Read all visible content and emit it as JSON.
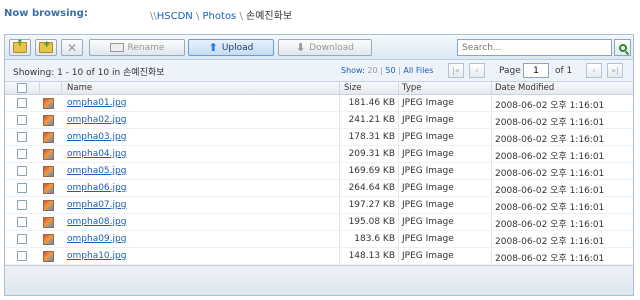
{
  "header": {
    "now_browsing_label": "Now browsing:",
    "breadcrumb_prefix": "\\\\",
    "crumbs": [
      "HSCDN",
      "Photos",
      "손예진화보"
    ],
    "sep": "\\"
  },
  "toolbar": {
    "rename_label": "Rename",
    "upload_label": "Upload",
    "download_label": "Download",
    "search_placeholder": "Search..."
  },
  "info": {
    "showing_text": "Showing: 1 - 10 of 10 in 손예진화보",
    "show_label": "Show:",
    "show_20": "20",
    "show_50": "50",
    "show_all": "All Files",
    "show_sep": "|",
    "page_label": "Page",
    "page_value": "1",
    "of_label": "of 1",
    "nav_first": "|«",
    "nav_prev": "‹",
    "nav_next": "›",
    "nav_last": "»|"
  },
  "columns": {
    "name": "Name",
    "size": "Size",
    "type": "Type",
    "date": "Date Modified"
  },
  "files": [
    {
      "name": "ompha01.jpg",
      "size": "181.46 KB",
      "type": "JPEG Image",
      "date": "2008-06-02 오후 1:16:01"
    },
    {
      "name": "ompha02.jpg",
      "size": "241.21 KB",
      "type": "JPEG Image",
      "date": "2008-06-02 오후 1:16:01"
    },
    {
      "name": "ompha03.jpg",
      "size": "178.31 KB",
      "type": "JPEG Image",
      "date": "2008-06-02 오후 1:16:01"
    },
    {
      "name": "ompha04.jpg",
      "size": "209.31 KB",
      "type": "JPEG Image",
      "date": "2008-06-02 오후 1:16:01"
    },
    {
      "name": "ompha05.jpg",
      "size": "169.69 KB",
      "type": "JPEG Image",
      "date": "2008-06-02 오후 1:16:01"
    },
    {
      "name": "ompha06.jpg",
      "size": "264.64 KB",
      "type": "JPEG Image",
      "date": "2008-06-02 오후 1:16:01"
    },
    {
      "name": "ompha07.jpg",
      "size": "197.27 KB",
      "type": "JPEG Image",
      "date": "2008-06-02 오후 1:16:01"
    },
    {
      "name": "ompha08.jpg",
      "size": "195.08 KB",
      "type": "JPEG Image",
      "date": "2008-06-02 오후 1:16:01"
    },
    {
      "name": "ompha09.jpg",
      "size": "183.6 KB",
      "type": "JPEG Image",
      "date": "2008-06-02 오후 1:16:01"
    },
    {
      "name": "ompha10.jpg",
      "size": "148.13 KB",
      "type": "JPEG Image",
      "date": "2008-06-02 오후 1:16:01"
    }
  ],
  "colors": {
    "accent": "#1a5fb4",
    "header_text": "#3b6fa8",
    "toolbar_bg": "#dde8f3"
  }
}
